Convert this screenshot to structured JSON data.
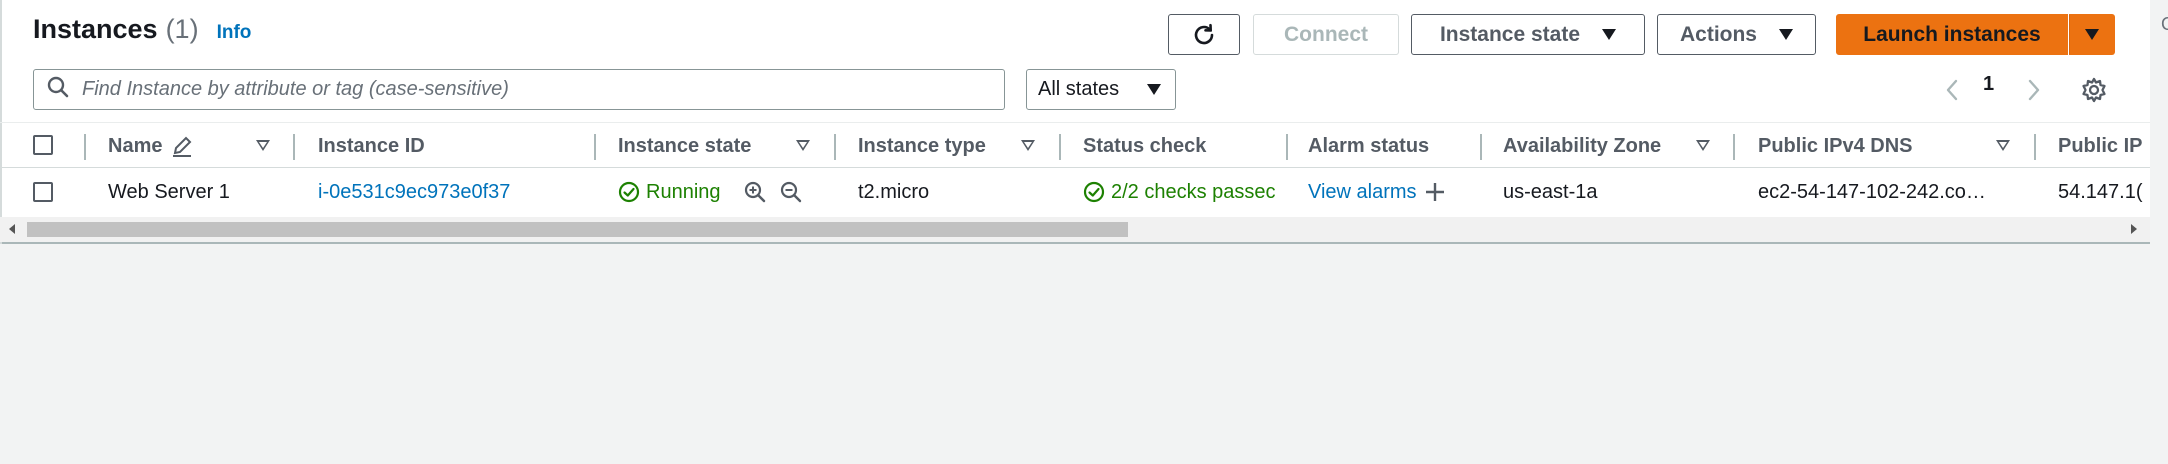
{
  "header": {
    "title": "Instances",
    "count": "(1)",
    "info_label": "Info"
  },
  "toolbar": {
    "refresh_icon": "refresh-icon",
    "connect_label": "Connect",
    "instance_state_label": "Instance state",
    "actions_label": "Actions",
    "launch_label": "Launch instances"
  },
  "search": {
    "placeholder": "Find Instance by attribute or tag (case-sensitive)",
    "value": ""
  },
  "filter": {
    "selected": "All states"
  },
  "pagination": {
    "current_page": "1"
  },
  "table": {
    "columns": [
      "Name",
      "Instance ID",
      "Instance state",
      "Instance type",
      "Status check",
      "Alarm status",
      "Availability Zone",
      "Public IPv4 DNS",
      "Public IP"
    ],
    "rows": [
      {
        "name": "Web Server 1",
        "instance_id": "i-0e531c9ec973e0f37",
        "state": "Running",
        "type": "t2.micro",
        "status_check": "2/2 checks passec",
        "alarm_status": "View alarms",
        "zone": "us-east-1a",
        "dns": "ec2-54-147-102-242.co…",
        "public_ip": "54.147.1("
      }
    ]
  },
  "colors": {
    "accent_orange": "#ec7211",
    "link_blue": "#0073bb",
    "success_green": "#1d8102"
  }
}
